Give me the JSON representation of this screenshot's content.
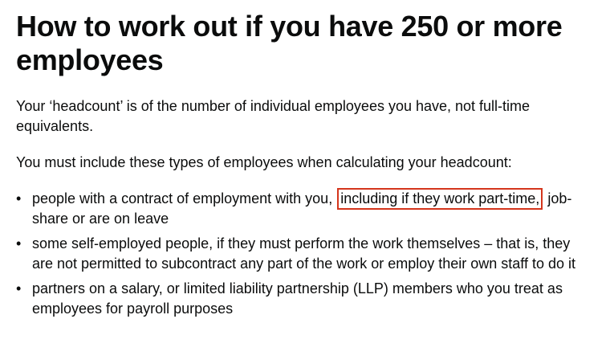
{
  "heading": "How to work out if you have 250 or more employees",
  "intro": "Your ‘headcount’ is of the number of individual employees you have, not full-time equivalents.",
  "lead": "You must include these types of employees when calculating your headcount:",
  "bullet_glyph": "•",
  "list": {
    "item1": {
      "before": "people with a contract of employment with you, ",
      "highlight": "including if they work part-time,",
      "after": " job-share or are on leave"
    },
    "item2": "some self-employed people, if they must perform the work themselves – that is, they are not permitted to subcontract any part of the work or employ their own staff to do it",
    "item3": "partners on a salary, or limited liability partnership (LLP) members who you treat as employees for payroll purposes"
  },
  "colors": {
    "text": "#0b0c0c",
    "highlight_border": "#d4351c",
    "background": "#ffffff"
  }
}
